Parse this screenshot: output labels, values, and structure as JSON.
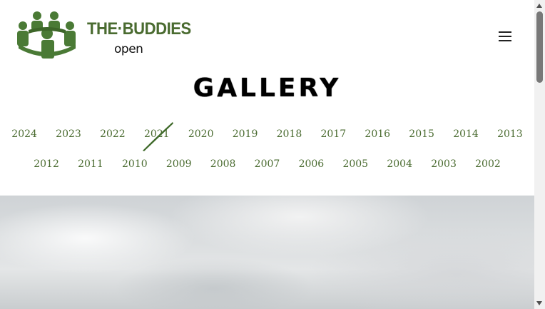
{
  "header": {
    "brand_name": "THE·BUDDIES",
    "brand_sub": "open",
    "logo_color": "#4a6b30",
    "menu_icon": "hamburger-menu-icon"
  },
  "page_title": "GALLERY",
  "years_row1": [
    "2024",
    "2023",
    "2022",
    "2021",
    "2020",
    "2019",
    "2018",
    "2017",
    "2016",
    "2015",
    "2014",
    "2013"
  ],
  "years_row2": [
    "2012",
    "2011",
    "2010",
    "2009",
    "2008",
    "2007",
    "2006",
    "2005",
    "2004",
    "2003",
    "2002"
  ],
  "link_color": "#4a6b30"
}
